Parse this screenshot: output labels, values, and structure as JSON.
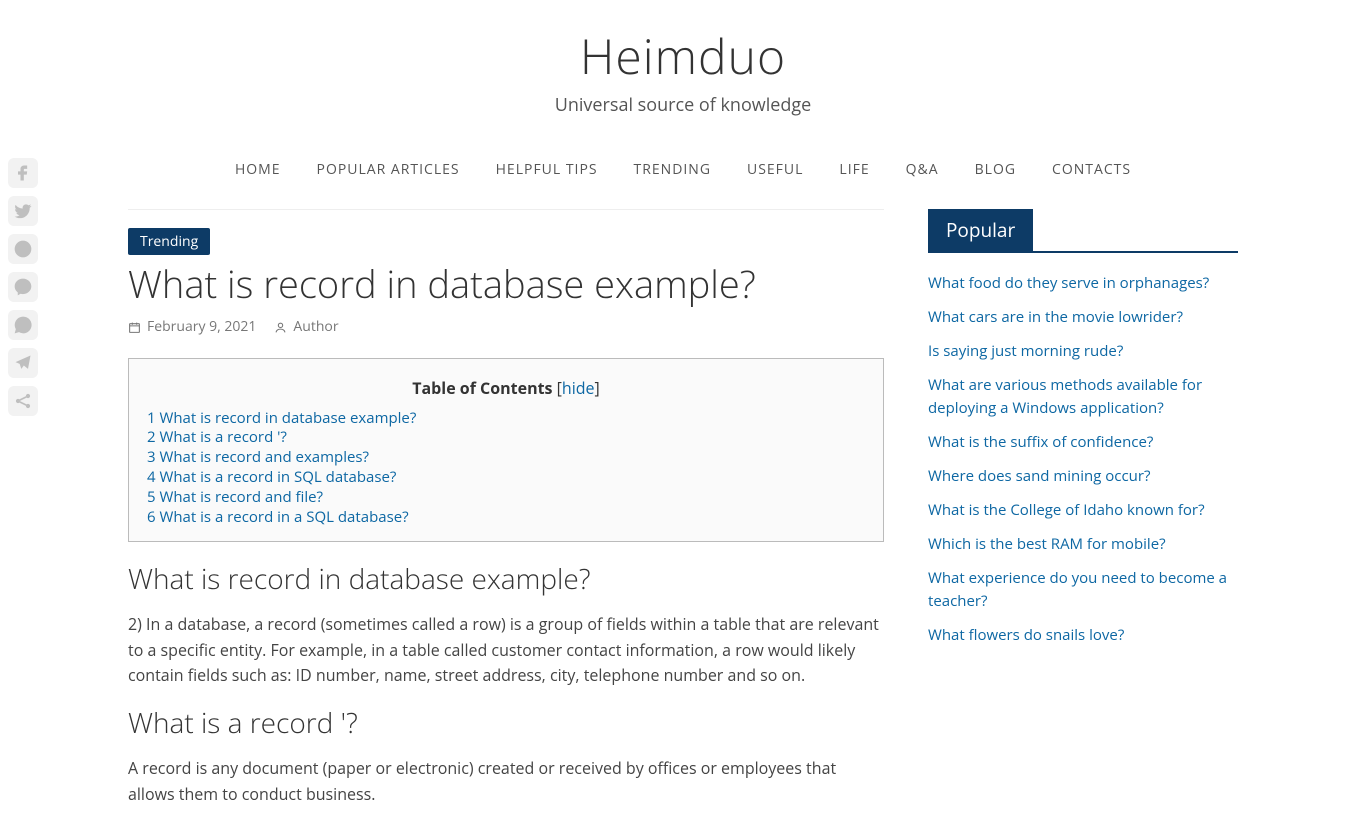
{
  "header": {
    "title": "Heimduo",
    "tagline": "Universal source of knowledge"
  },
  "nav": {
    "items": [
      "HOME",
      "POPULAR ARTICLES",
      "HELPFUL TIPS",
      "TRENDING",
      "USEFUL",
      "LIFE",
      "Q&A",
      "BLOG",
      "CONTACTS"
    ]
  },
  "article": {
    "category": "Trending",
    "title": "What is record in database example?",
    "date": "February 9, 2021",
    "author": "Author",
    "toc": {
      "label": "Table of Contents",
      "hide": "hide",
      "items": [
        {
          "num": "1",
          "text": "What is record in database example?"
        },
        {
          "num": "2",
          "text": "What is a record '?"
        },
        {
          "num": "3",
          "text": "What is record and examples?"
        },
        {
          "num": "4",
          "text": "What is a record in SQL database?"
        },
        {
          "num": "5",
          "text": "What is record and file?"
        },
        {
          "num": "6",
          "text": "What is a record in a SQL database?"
        }
      ]
    },
    "sections": [
      {
        "heading": "What is record in database example?",
        "body": "2) In a database, a record (sometimes called a row) is a group of fields within a table that are relevant to a specific entity. For example, in a table called customer contact information, a row would likely contain fields such as: ID number, name, street address, city, telephone number and so on."
      },
      {
        "heading": "What is a record '?",
        "body": "A record is any document (paper or electronic) created or received by offices or employees that allows them to conduct business."
      }
    ]
  },
  "sidebar": {
    "popular_title": "Popular",
    "popular": [
      "What food do they serve in orphanages?",
      "What cars are in the movie lowrider?",
      "Is saying just morning rude?",
      "What are various methods available for deploying a Windows application?",
      "What is the suffix of confidence?",
      "Where does sand mining occur?",
      "What is the College of Idaho known for?",
      "Which is the best RAM for mobile?",
      "What experience do you need to become a teacher?",
      "What flowers do snails love?"
    ]
  },
  "share": [
    "facebook",
    "twitter",
    "reddit",
    "messenger",
    "whatsapp",
    "telegram",
    "share"
  ]
}
